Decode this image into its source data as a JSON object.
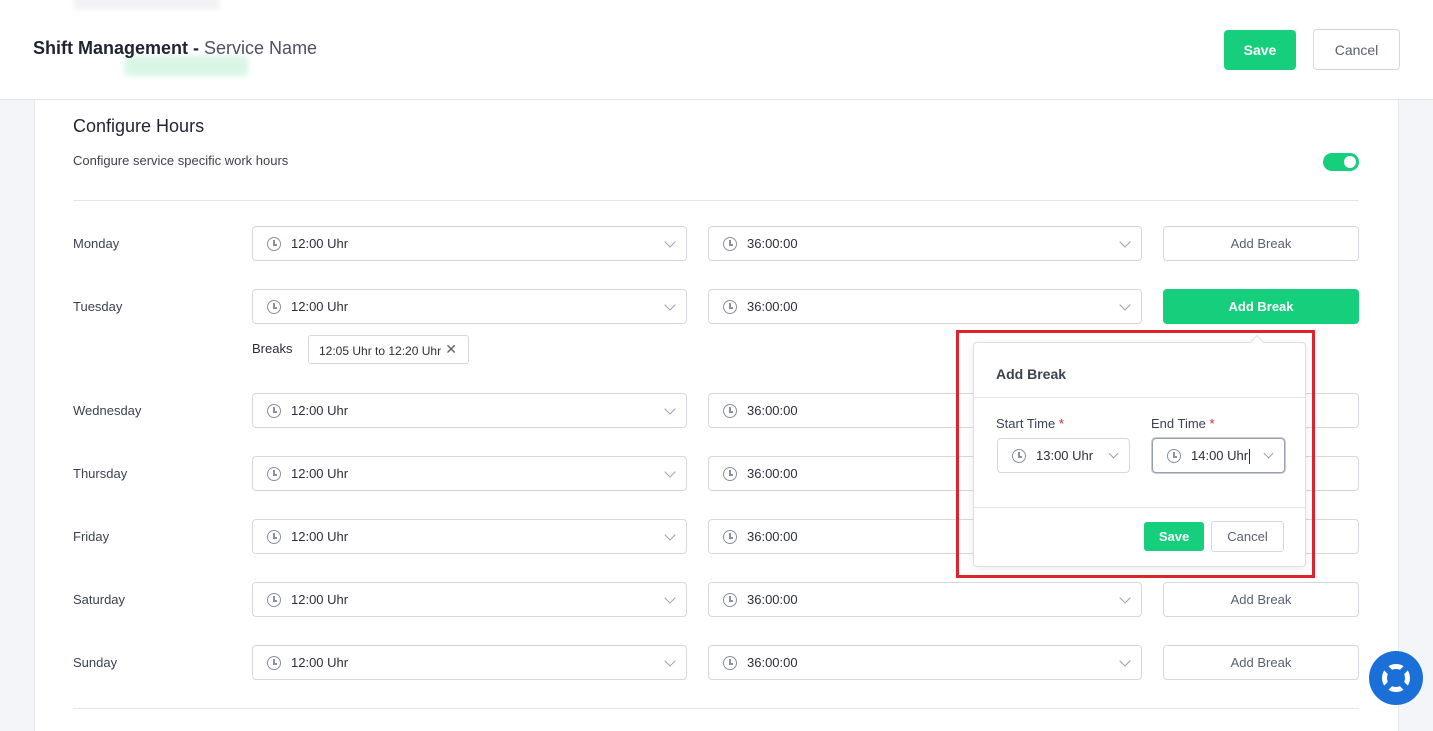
{
  "header": {
    "title_bold": "Shift Management -",
    "title_service": "Service Name",
    "save_label": "Save",
    "cancel_label": "Cancel"
  },
  "configure": {
    "title": "Configure Hours",
    "subtitle": "Configure service specific work hours",
    "toggle_on": true
  },
  "days": [
    {
      "label": "Monday",
      "start": "12:00 Uhr",
      "end": "36:00:00",
      "button": "Add Break"
    },
    {
      "label": "Tuesday",
      "start": "12:00 Uhr",
      "end": "36:00:00",
      "button": "Add Break"
    },
    {
      "label": "Wednesday",
      "start": "12:00 Uhr",
      "end": "36:00:00"
    },
    {
      "label": "Thursday",
      "start": "12:00 Uhr",
      "end": "36:00:00"
    },
    {
      "label": "Friday",
      "start": "12:00 Uhr",
      "end": "36:00:00"
    },
    {
      "label": "Saturday",
      "start": "12:00 Uhr",
      "end": "36:00:00",
      "button": "Add Break"
    },
    {
      "label": "Sunday",
      "start": "12:00 Uhr",
      "end": "36:00:00",
      "button": "Add Break"
    }
  ],
  "breaks": {
    "label": "Breaks",
    "items": [
      "12:05 Uhr to 12:20 Uhr"
    ]
  },
  "popover": {
    "title": "Add Break",
    "start_label": "Start Time",
    "end_label": "End Time",
    "required_mark": "*",
    "start_value": "13:00 Uhr",
    "end_value": "14:00 Uhr",
    "save_label": "Save",
    "cancel_label": "Cancel"
  },
  "colors": {
    "accent": "#16cf7c",
    "highlight": "#e0232b",
    "help": "#1a6fd8"
  },
  "icons": {
    "time": "clock-icon",
    "dropdown": "chevron-down-icon",
    "remove": "close-icon",
    "help": "lifebuoy-icon"
  }
}
